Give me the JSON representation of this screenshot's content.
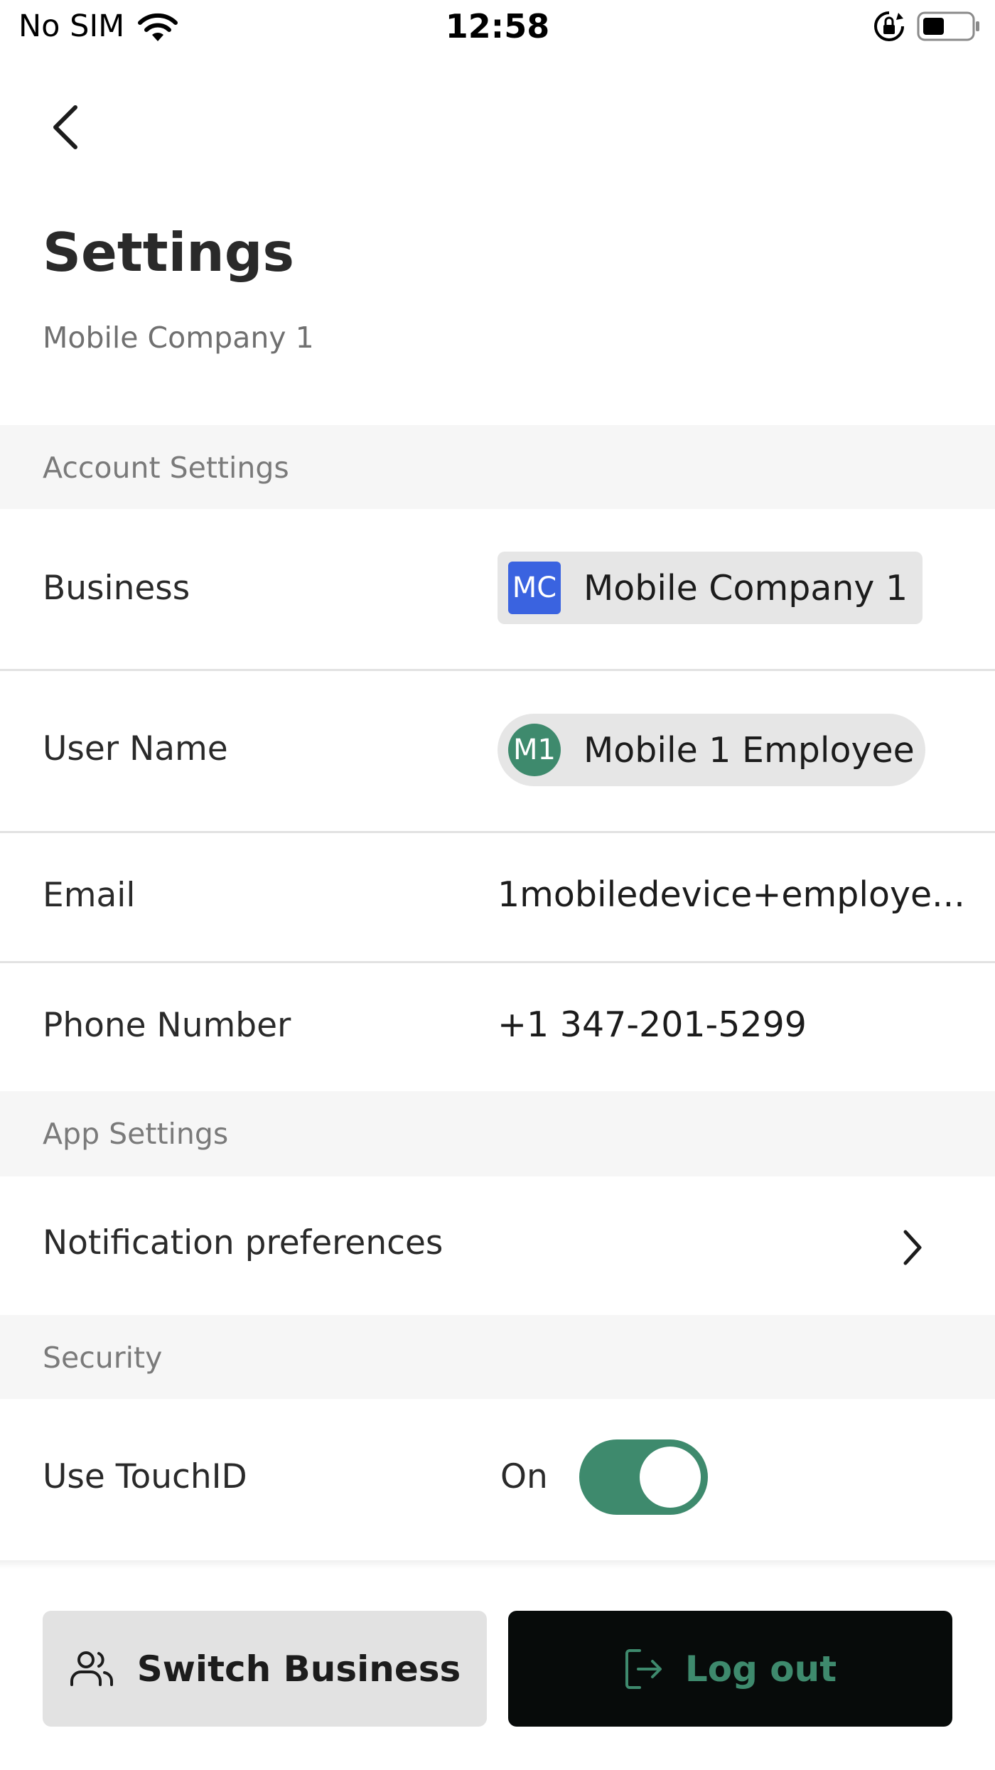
{
  "status_bar": {
    "carrier": "No SIM",
    "time": "12:58"
  },
  "header": {
    "title": "Settings",
    "subtitle": "Mobile Company 1"
  },
  "sections": {
    "account": {
      "title": "Account Settings",
      "business_label": "Business",
      "business_initials": "MC",
      "business_name": "Mobile Company 1",
      "user_label": "User Name",
      "user_initials": "M1",
      "user_name": "Mobile 1 Employee",
      "email_label": "Email",
      "email_value": "1mobiledevice+employe...",
      "phone_label": "Phone Number",
      "phone_value": "+1 347-201-5299"
    },
    "app": {
      "title": "App Settings",
      "notifications_label": "Notification preferences"
    },
    "security": {
      "title": "Security",
      "touchid_label": "Use TouchID",
      "touchid_state": "On"
    }
  },
  "actions": {
    "switch_business": "Switch Business",
    "log_out": "Log out"
  },
  "colors": {
    "accent": "#3e8a6d",
    "business_avatar": "#3a63e0",
    "user_avatar": "#3e8a6d"
  }
}
